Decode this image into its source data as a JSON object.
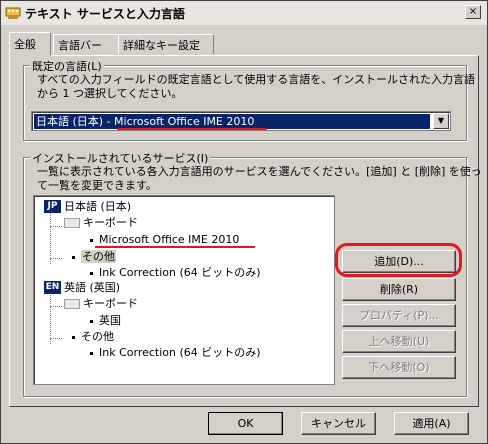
{
  "window": {
    "title": "テキスト サービスと入力言語",
    "close_glyph": "×"
  },
  "tabs": [
    {
      "label": "全般"
    },
    {
      "label": "言語バー"
    },
    {
      "label": "詳細なキー設定"
    }
  ],
  "default_language": {
    "legend": "既定の言語(L)",
    "desc_line1": "すべての入力フィールドの既定言語として使用する言語を、インストールされた入力言語",
    "desc_line2": "から 1 つ選択してください。",
    "selected_value": "日本語 (日本) - Microsoft Office IME 2010",
    "arrow_glyph": "▼"
  },
  "installed_services": {
    "legend": "インストールされているサービス(I)",
    "desc_line1": "一覧に表示されている各入力言語用のサービスを選んでください。[追加] と [削除] を使っ",
    "desc_line2": "て一覧を変更できます。",
    "tree": {
      "lang1": {
        "badge": "JP",
        "label": "日本語 (日本)"
      },
      "lang1_keyboard": "キーボード",
      "lang1_keyboard_item": "Microsoft Office IME 2010",
      "lang1_other": "その他",
      "lang1_other_item": "Ink Correction (64 ビットのみ)",
      "lang2": {
        "badge": "EN",
        "label": "英語 (英国)"
      },
      "lang2_keyboard": "キーボード",
      "lang2_keyboard_item": "英国",
      "lang2_other": "その他",
      "lang2_other_item": "Ink Correction (64 ビットのみ)"
    },
    "buttons": {
      "add": "追加(D)...",
      "remove": "削除(R)",
      "properties": "プロパティ(P)...",
      "move_up": "上へ移動(U)",
      "move_down": "下へ移動(O)"
    }
  },
  "footer": {
    "ok": "OK",
    "cancel": "キャンセル",
    "apply": "適用(A)"
  },
  "colors": {
    "highlight": "#0a246a",
    "annotation_red": "#e8141e",
    "dialog_bg": "#d4d0c8"
  }
}
